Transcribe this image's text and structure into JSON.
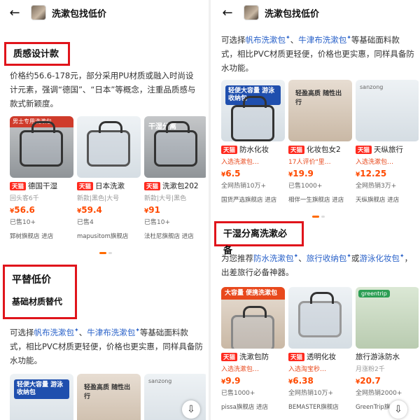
{
  "header": {
    "back_icon": "arrow-left-icon",
    "title": "洗漱包找低价"
  },
  "left": {
    "section1": {
      "heading": "质感设计款",
      "desc": "价格约56.6-178元，部分采用PU材质或融入时尚设计元素，强调“德国”、“日本”等概念，注重品质感与款式新颖度。"
    },
    "products1": [
      {
        "badge": "男士专用洗漱包",
        "tag": "天猫",
        "name": "德国干湿",
        "sub": "回头客6千",
        "price_symbol": "¥",
        "price": "56.6",
        "sold": "已售10+",
        "store": "郅树旗舰店 进店"
      },
      {
        "badge": "",
        "tag": "天猫",
        "name": "日本洗漱",
        "sub": "新款|黑色|大号",
        "price_symbol": "¥",
        "price": "59.4",
        "sold": "已售4",
        "store": "mapusitom旗舰店"
      },
      {
        "badge": "干湿分离",
        "tag": "天猫",
        "name": "洗漱包202",
        "sub": "新款|大号|黑色",
        "price_symbol": "¥",
        "price": "91",
        "sold": "已售10+",
        "store": "法杜尼旗舰店 进店"
      }
    ],
    "section2": {
      "heading": "平替低价",
      "subheading": "基础材质替代",
      "desc_pre": "可选择",
      "link1": "帆布洗漱包",
      "sep": "、",
      "link2": "牛津布洗漱包",
      "desc_post": "等基础面料款式，相比PVC材质更轻便，价格也更实惠，同样具备防水功能。"
    },
    "products2": [
      {
        "banner": "轻便大容量 游泳收纳包"
      },
      {
        "banner": "轻盈高质 随性出行"
      },
      {
        "banner": "sanzong"
      }
    ]
  },
  "right": {
    "top_text_pre": "可选择",
    "top_link1": "帆布洗漱包",
    "top_sep": "、",
    "top_link2": "牛津布洗漱包",
    "top_text_post": "等基础面料款式，相比PVC材质更轻便，价格也更实惠，同样具备防水功能。",
    "products1": [
      {
        "badge": "轻便大容量 游泳收纳包",
        "tag": "天猫",
        "name": "防水化妆",
        "sub": "入选洗漱包…",
        "price_symbol": "¥",
        "price": "6.5",
        "sold": "全网热销10万+",
        "store": "国货严选旗舰店 进店"
      },
      {
        "badge": "轻盈高质 随性出行",
        "tag": "天猫",
        "name": "化妆包女2",
        "sub": "17人评价\"里…",
        "price_symbol": "¥",
        "price": "19.9",
        "sold": "已售1000+",
        "store": "相伴一生旗舰店 进店"
      },
      {
        "badge": "sanzong",
        "tag": "天猫",
        "name": "天纵旅行",
        "sub": "入选洗漱包…",
        "price_symbol": "¥",
        "price": "12.25",
        "sold": "全网热销3万+",
        "store": "天纵旗舰店 进店"
      }
    ],
    "section": {
      "heading": "干湿分离洗漱必备",
      "desc_pre": "为您推荐",
      "link1": "防水洗漱包",
      "sep1": "、",
      "link2": "旅行收纳包",
      "sep2": "或",
      "link3": "游泳化妆包",
      "desc_post": "，出差旅行必备神器。"
    },
    "products2": [
      {
        "badge": "大容量 便携洗漱包",
        "tag": "天猫",
        "name": "洗漱包防",
        "sub": "入选洗漱包…",
        "price_symbol": "¥",
        "price": "9.9",
        "sold": "已售1000+",
        "store": "pissa旗舰店 进店"
      },
      {
        "badge": "",
        "tag": "天猫",
        "name": "透明化妆",
        "sub": "入选淘宝秒…",
        "price_symbol": "¥",
        "price": "6.38",
        "sold": "全网热销10万+",
        "store": "BEMASTER旗舰店"
      },
      {
        "badge": "greentrip",
        "tag": "",
        "name": "旅行游泳防水",
        "sub": "月涨粉2千",
        "price_symbol": "¥",
        "price": "20.7",
        "sold": "全网热销2000+",
        "store": "GreenTrip旗舰店"
      }
    ]
  },
  "icons": {
    "download": "download-icon"
  },
  "colors": {
    "highlight_border": "#e0141b",
    "price": "#ff4a00",
    "link": "#2a62c9",
    "tmall": "#ff2a1f"
  }
}
